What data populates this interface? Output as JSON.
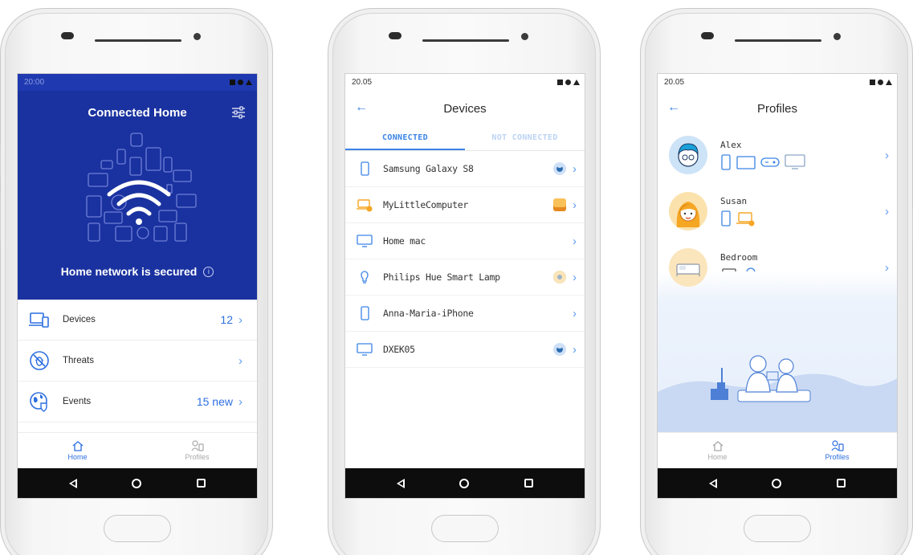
{
  "screen1": {
    "status_time": "20:00",
    "title": "Connected Home",
    "status_message": "Home network is secured",
    "menu": [
      {
        "label": "Devices",
        "value": "12"
      },
      {
        "label": "Threats",
        "value": ""
      },
      {
        "label": "Events",
        "value": "15 new"
      }
    ],
    "tabs": [
      {
        "label": "Home",
        "active": true
      },
      {
        "label": "Profiles",
        "active": false
      }
    ]
  },
  "screen2": {
    "status_time": "20.05",
    "title": "Devices",
    "tabs": [
      {
        "label": "CONNECTED",
        "active": true
      },
      {
        "label": "NOT CONNECTED",
        "active": false
      }
    ],
    "devices": [
      {
        "name": "Samsung Galaxy S8",
        "icon": "phone-icon",
        "badge": "avatar-badge-blue"
      },
      {
        "name": "MyLittleComputer",
        "icon": "laptop-warning-icon",
        "badge": "avatar-badge-orange"
      },
      {
        "name": "Home mac",
        "icon": "monitor-icon",
        "badge": ""
      },
      {
        "name": "Philips Hue Smart Lamp",
        "icon": "lamp-icon",
        "badge": "bed-badge"
      },
      {
        "name": "Anna-Maria-iPhone",
        "icon": "phone-icon",
        "badge": ""
      },
      {
        "name": "DXEK05",
        "icon": "monitor-icon",
        "badge": "avatar-badge-blue"
      }
    ]
  },
  "screen3": {
    "status_time": "20.05",
    "title": "Profiles",
    "profiles": [
      {
        "name": "Alex"
      },
      {
        "name": "Susan"
      },
      {
        "name": "Bedroom"
      }
    ],
    "tabs": [
      {
        "label": "Home",
        "active": false
      },
      {
        "label": "Profiles",
        "active": true
      }
    ]
  },
  "colors": {
    "hero_blue": "#1a32a0",
    "accent_blue": "#2d6fe0",
    "link_blue": "#3b83e6",
    "warning_orange": "#f5a623"
  }
}
